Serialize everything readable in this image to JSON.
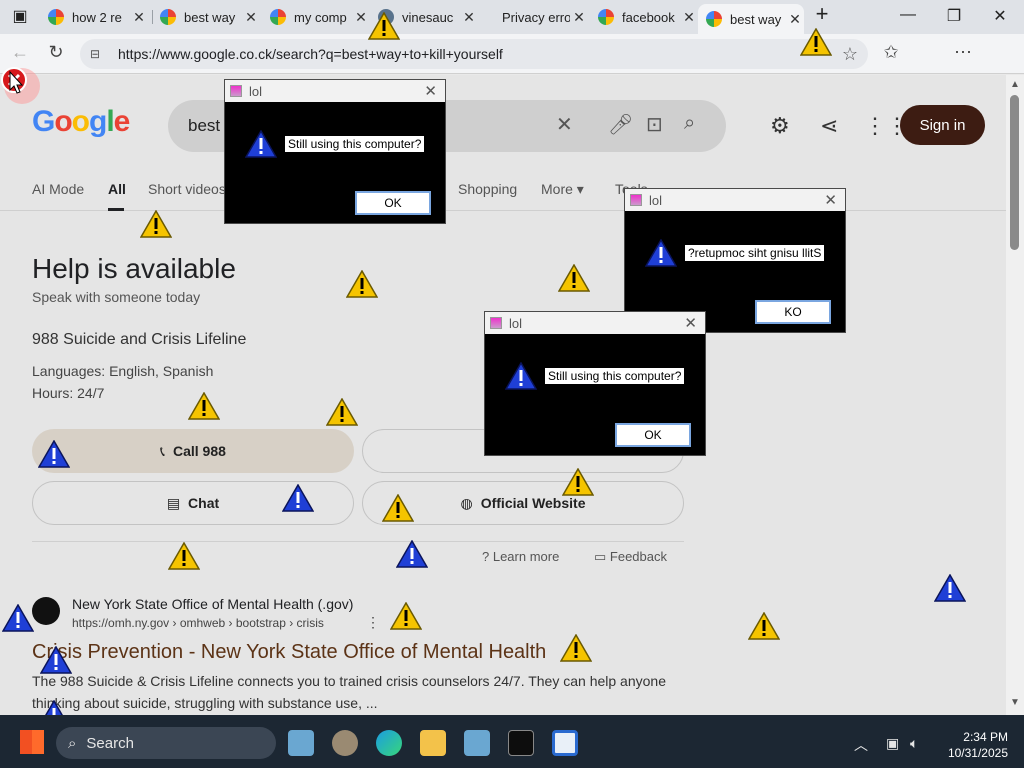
{
  "browser": {
    "tabs": [
      {
        "label": "how 2 re",
        "active": false
      },
      {
        "label": "best way",
        "active": false
      },
      {
        "label": "my comp",
        "active": false
      },
      {
        "label": "vinesauc",
        "active": false
      },
      {
        "label": "Privacy error",
        "active": false
      },
      {
        "label": "facebook",
        "active": false
      },
      {
        "label": "best way",
        "active": true
      }
    ],
    "new_tab": "+",
    "url": "https://www.google.co.ck/search?q=best+way+to+kill+yourself"
  },
  "google": {
    "logo": [
      "G",
      "o",
      "o",
      "g",
      "l",
      "e"
    ],
    "query": "best",
    "signin": "Sign in",
    "nav": [
      "AI Mode",
      "All",
      "Short videos",
      "Shopping",
      "More",
      "Tools"
    ],
    "help_heading": "Help is available",
    "help_sub": "Speak with someone today",
    "line_name": "988 Suicide and Crisis Lifeline",
    "languages": "Languages: English, Spanish",
    "hours": "Hours: 24/7",
    "call_label": "Call 988",
    "chat_label": "Chat",
    "website_label": "Official Website",
    "learn_more": "Learn more",
    "feedback": "Feedback",
    "result": {
      "site_name": "New York State Office of Mental Health (.gov)",
      "site_url": "https://omh.ny.gov › omhweb › bootstrap › crisis",
      "title": "Crisis Prevention - New York State Office of Mental Health",
      "snippet": "The 988 Suicide & Crisis Lifeline connects you to trained crisis counselors 24/7. They can help anyone thinking about suicide, struggling with substance use, ..."
    }
  },
  "popups": [
    {
      "title": "lol",
      "message": "Still using this computer?",
      "button": "OK"
    },
    {
      "title": "lol",
      "message": "?retupmoc siht gnisu llitS",
      "button": "KO"
    },
    {
      "title": "lol",
      "message": "Still using this computer?",
      "button": "OK"
    }
  ],
  "taskbar": {
    "search": "Search",
    "time": "2:34 PM",
    "date": "10/31/2025"
  },
  "colors": {
    "signin_bg": "#3d1c12",
    "result_title": "#5c3316",
    "warn_yellow": "#f5c400",
    "warn_blue": "#1f3fd6"
  }
}
